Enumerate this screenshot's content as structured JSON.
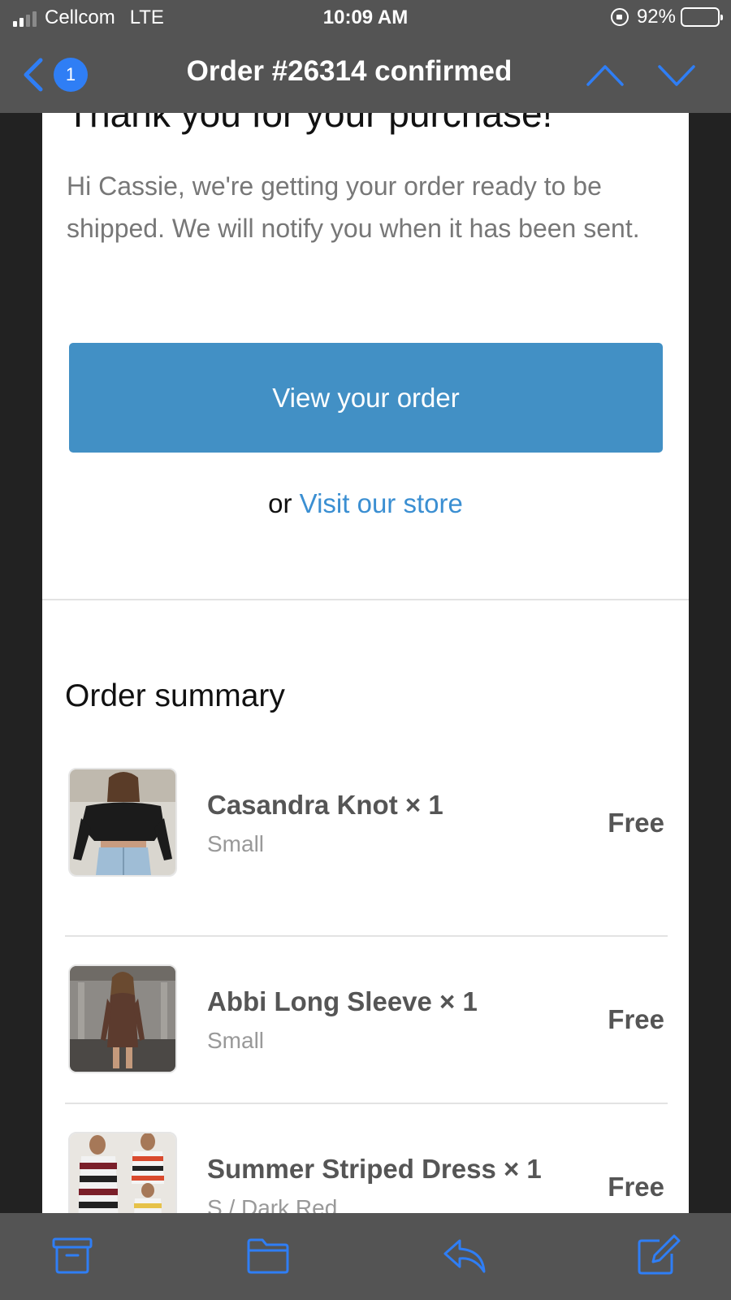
{
  "status_bar": {
    "carrier": "Cellcom",
    "network": "LTE",
    "time": "10:09 AM",
    "battery": "92%"
  },
  "nav": {
    "back_count": "1",
    "title": "Order #26314 confirmed"
  },
  "email": {
    "heading": "Thank you for your purchase!",
    "intro": "Hi Cassie, we're getting your order ready to be shipped. We will notify you when it has been sent.",
    "cta_label": "View your order",
    "or_text": "or",
    "store_link": "Visit our store",
    "summary_title": "Order summary",
    "items": [
      {
        "name": "Casandra Knot × 1",
        "variant": "Small",
        "price": "Free"
      },
      {
        "name": "Abbi Long Sleeve × 1",
        "variant": "Small",
        "price": "Free"
      },
      {
        "name": "Summer Striped Dress × 1",
        "variant": "S / Dark Red",
        "price": "Free"
      }
    ]
  },
  "icons": {
    "accent_color": "#2f7ef5",
    "toolbar": [
      "archive-icon",
      "folder-icon",
      "reply-icon",
      "compose-icon"
    ]
  },
  "colors": {
    "cta_background": "#4290c5",
    "link": "#3b8fd2",
    "chrome": "#545454"
  }
}
